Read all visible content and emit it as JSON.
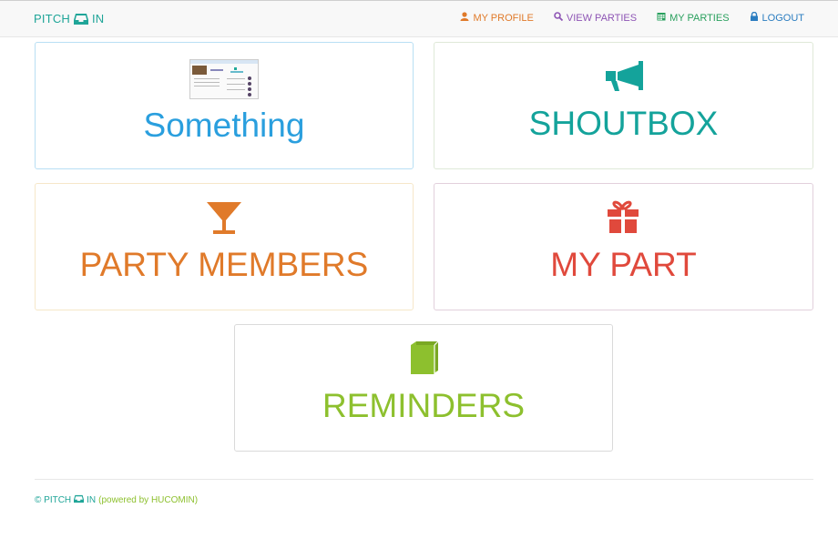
{
  "colors": {
    "teal": "#1fa598",
    "orange": "#e07a2a",
    "purple": "#8e55b5",
    "green_nav": "#2aa05e",
    "blue_nav": "#2b7dc0",
    "tile_blue": "#2a9fde",
    "tile_teal": "#14a39b",
    "tile_orange": "#e07a2a",
    "tile_red": "#e0493c",
    "tile_green": "#8dc02e"
  },
  "brand": {
    "left": "PITCH",
    "right": "IN",
    "icon": "inbox-icon"
  },
  "nav": [
    {
      "label": "MY PROFILE",
      "icon": "user-icon"
    },
    {
      "label": "VIEW PARTIES",
      "icon": "search-icon"
    },
    {
      "label": "MY PARTIES",
      "icon": "calendar-icon"
    },
    {
      "label": "LOGOUT",
      "icon": "lock-icon"
    }
  ],
  "tiles": [
    {
      "title": "Something",
      "icon": "screenshot-thumbnail"
    },
    {
      "title": "SHOUTBOX",
      "icon": "bullhorn-icon"
    },
    {
      "title": "PARTY MEMBERS",
      "icon": "cocktail-glass-icon"
    },
    {
      "title": "MY PART",
      "icon": "gift-icon"
    },
    {
      "title": "REMINDERS",
      "icon": "book-icon"
    }
  ],
  "footer": {
    "prefix": "© PITCH",
    "suffix": "IN",
    "powered": "(powered by HUCOMIN)"
  }
}
